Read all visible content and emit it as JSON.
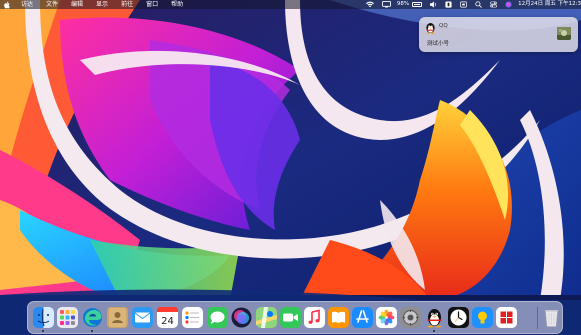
{
  "menubar": {
    "items": [
      "访达",
      "文件",
      "编辑",
      "显示",
      "前往",
      "窗口",
      "帮助"
    ],
    "battery_percent": "98%",
    "battery_level": 0.98,
    "datetime": "12月24日 周五 下午12:3"
  },
  "notification": {
    "app_name": "QQ",
    "message": "测试小号",
    "icon": "qq-penguin-icon"
  },
  "dock": {
    "apps": [
      {
        "name": "finder",
        "icon": "finder-icon"
      },
      {
        "name": "launchpad",
        "icon": "launchpad-icon"
      },
      {
        "name": "edge",
        "icon": "edge-icon"
      },
      {
        "name": "contacts",
        "icon": "contacts-icon"
      },
      {
        "name": "mail",
        "icon": "mail-icon"
      },
      {
        "name": "calendar",
        "icon": "calendar-icon",
        "date": "24"
      },
      {
        "name": "reminders",
        "icon": "reminders-icon"
      },
      {
        "name": "messages",
        "icon": "messages-icon"
      },
      {
        "name": "siri",
        "icon": "siri-icon"
      },
      {
        "name": "maps",
        "icon": "maps-icon"
      },
      {
        "name": "facetime",
        "icon": "facetime-icon"
      },
      {
        "name": "music",
        "icon": "music-icon"
      },
      {
        "name": "books",
        "icon": "books-icon"
      },
      {
        "name": "app-store",
        "icon": "app-store-icon"
      },
      {
        "name": "photos",
        "icon": "photos-icon"
      },
      {
        "name": "system-preferences",
        "icon": "system-preferences-icon"
      },
      {
        "name": "qq",
        "icon": "qq-icon"
      },
      {
        "name": "clock",
        "icon": "clock-icon"
      },
      {
        "name": "tips",
        "icon": "tips-icon"
      },
      {
        "name": "windows-app",
        "icon": "windows-icon"
      },
      {
        "name": "trash",
        "icon": "trash-icon"
      }
    ]
  },
  "colors": {
    "menubar_bg": "#14162a",
    "dock_bg": "#e6e2ec",
    "notification_bg": "#e8e4ec"
  }
}
